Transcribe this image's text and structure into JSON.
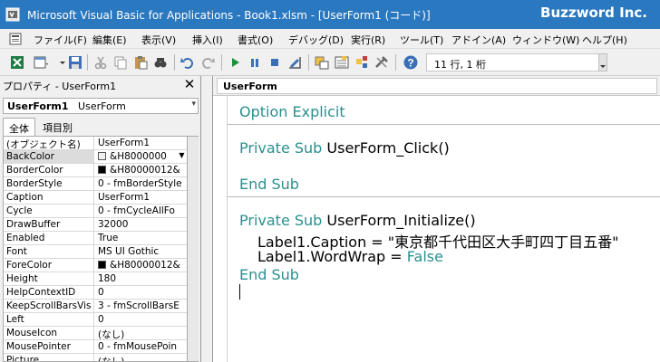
{
  "titlebar": {
    "title": "Microsoft Visual Basic for Applications - Book1.xlsm - [UserForm1 (コード)]",
    "brand": "Buzzword Inc."
  },
  "menu": {
    "items": [
      "ファイル(F)",
      "編集(E)",
      "表示(V)",
      "挿入(I)",
      "書式(O)",
      "デバッグ(D)",
      "実行(R)",
      "ツール(T)",
      "アドイン(A)",
      "ウィンドウ(W)",
      "ヘルプ(H)"
    ]
  },
  "toolbar": {
    "cursor_position": "11 行, 1 桁"
  },
  "properties": {
    "title": "プロパティ - UserForm1",
    "object_name": "UserForm1",
    "object_type": "UserForm",
    "tabs": [
      "全体",
      "項目別"
    ],
    "rows": [
      {
        "name": "(オブジェクト名)",
        "value": "UserForm1"
      },
      {
        "name": "BackColor",
        "value": "&H8000000"
      },
      {
        "name": "BorderColor",
        "value": "&H80000012&"
      },
      {
        "name": "BorderStyle",
        "value": "0 - fmBorderStyle"
      },
      {
        "name": "Caption",
        "value": "UserForm1"
      },
      {
        "name": "Cycle",
        "value": "0 - fmCycleAllFo"
      },
      {
        "name": "DrawBuffer",
        "value": "32000"
      },
      {
        "name": "Enabled",
        "value": "True"
      },
      {
        "name": "Font",
        "value": "MS UI Gothic"
      },
      {
        "name": "ForeColor",
        "value": "&H80000012&"
      },
      {
        "name": "Height",
        "value": "180"
      },
      {
        "name": "HelpContextID",
        "value": "0"
      },
      {
        "name": "KeepScrollBarsVis",
        "value": "3 - fmScrollBarsE"
      },
      {
        "name": "Left",
        "value": "0"
      },
      {
        "name": "MouseIcon",
        "value": "(なし)"
      },
      {
        "name": "MousePointer",
        "value": "0 - fmMousePoin"
      },
      {
        "name": "Picture",
        "value": "(なし)"
      }
    ]
  },
  "code": {
    "object_selector": "UserForm",
    "lines": {
      "l1_kw": "Option Explicit",
      "l2_kw": "Private Sub",
      "l2_rest": " UserForm_Click()",
      "l3_kw": "End Sub",
      "l4_kw": "Private Sub",
      "l4_rest": " UserForm_Initialize()",
      "l5": "Label1.Caption = \"東京都千代田区大手町四丁目五番\"",
      "l6_a": "Label1.WordWrap = ",
      "l6_kw": "False",
      "l7_kw": "End Sub"
    }
  },
  "colors": {
    "titlebar": "#2a78c0",
    "keyword": "#2b8f8f"
  }
}
